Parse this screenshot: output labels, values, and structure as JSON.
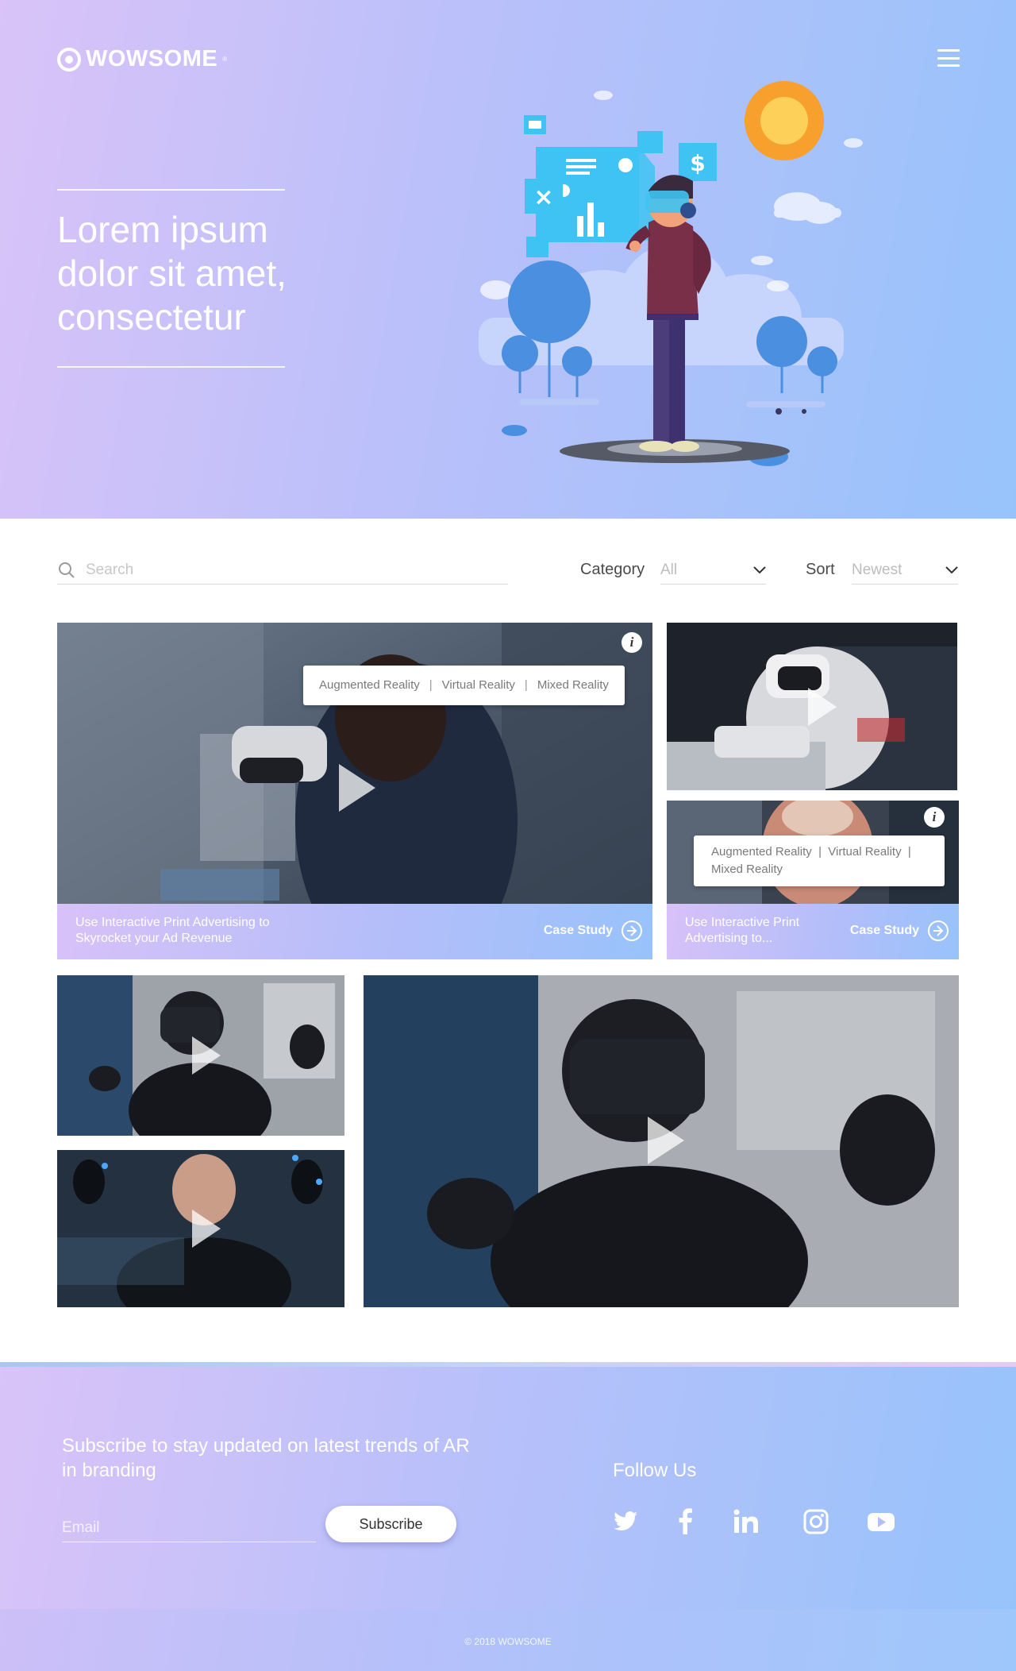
{
  "brand": {
    "name": "WOWSOME",
    "trademark": "®"
  },
  "hero": {
    "title": "Lorem ipsum dolor sit amet, consectetur",
    "illustration": "vr-person-with-hologram-illustration"
  },
  "filters": {
    "search_placeholder": "Search",
    "category_label": "Category",
    "category_value": "All",
    "sort_label": "Sort",
    "sort_value": "Newest"
  },
  "cards": [
    {
      "tags": [
        "Augmented Reality",
        "Virtual Reality",
        "Mixed Reality"
      ],
      "caption": "Use Interactive Print Advertising to Skyrocket your Ad Revenue",
      "cta": "Case Study"
    },
    {
      "tags": [],
      "caption": "",
      "cta": ""
    },
    {
      "tags_line1": "Augmented Reality  |  Virtual Reality  |",
      "tags_line2": "Mixed Reality",
      "caption": "Use Interactive Print Advertising to...",
      "cta": "Case Study"
    },
    {
      "tags": [],
      "caption": "",
      "cta": ""
    },
    {
      "tags": [],
      "caption": "",
      "cta": ""
    },
    {
      "tags": [],
      "caption": "",
      "cta": ""
    }
  ],
  "footer": {
    "subscribe_title": "Subscribe to stay updated on latest trends of AR in branding",
    "email_placeholder": "Email",
    "subscribe_label": "Subscribe",
    "follow_label": "Follow Us",
    "social": [
      "twitter-icon",
      "facebook-icon",
      "linkedin-icon",
      "instagram-icon",
      "youtube-icon"
    ],
    "copyright": "© 2018 WOWSOME"
  },
  "colors": {
    "gradient_start": "#d9c3f8",
    "gradient_end": "#97c3fb",
    "sun": "#f7a02d",
    "hologram": "#3fc3f3"
  }
}
